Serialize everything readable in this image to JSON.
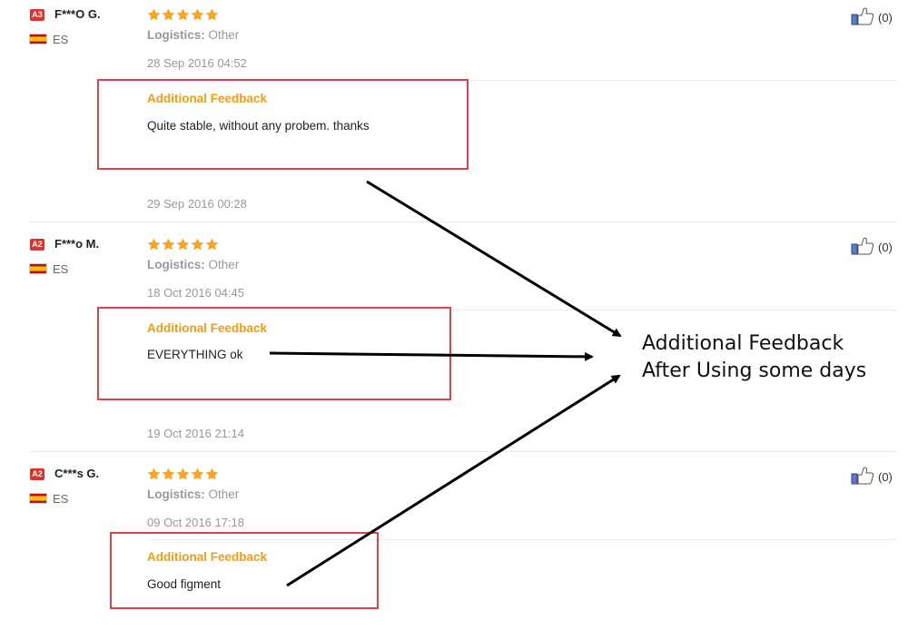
{
  "reviews": [
    {
      "level": "A3",
      "name": "F***O G.",
      "country": "ES",
      "stars": 5,
      "logistics_label": "Logistics:",
      "logistics_value": "Other",
      "date": "28 Sep 2016 04:52",
      "feedback_title": "Additional Feedback",
      "feedback_text": "Quite stable, without any probem. thanks",
      "feedback_date": "29 Sep 2016 00:28",
      "helpful_count": "(0)"
    },
    {
      "level": "A2",
      "name": "F***o M.",
      "country": "ES",
      "stars": 5,
      "logistics_label": "Logistics:",
      "logistics_value": "Other",
      "date": "18 Oct 2016 04:45",
      "feedback_title": "Additional Feedback",
      "feedback_text": "EVERYTHING ok",
      "feedback_date": "19 Oct 2016 21:14",
      "helpful_count": "(0)"
    },
    {
      "level": "A2",
      "name": "C***s G.",
      "country": "ES",
      "stars": 5,
      "logistics_label": "Logistics:",
      "logistics_value": "Other",
      "date": "09 Oct 2016 17:18",
      "feedback_title": "Additional Feedback",
      "feedback_text": "Good figment",
      "helpful_count": "(0)"
    }
  ],
  "annotation": {
    "line1": "Additional Feedback",
    "line2": "After Using some days"
  },
  "colors": {
    "star": "#f5a623",
    "feedback_title": "#f39c12",
    "highlight_box": "#e0404a",
    "badge": "#e0322b"
  },
  "icons": {
    "helpful": "thumbs-up-icon",
    "flag": "spain-flag-icon",
    "rating": "star-icon"
  }
}
